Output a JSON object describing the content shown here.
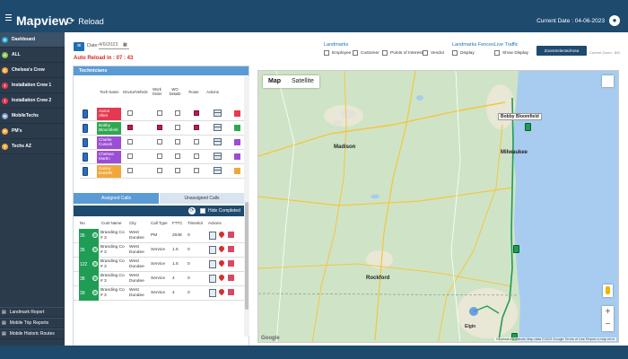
{
  "app": {
    "title": "Mapview",
    "reload_label": "Reload",
    "current_date": "Current Date : 04-06-2023"
  },
  "sidebar": {
    "items": [
      {
        "badge": "D",
        "label": "Dashboard",
        "color": "#29a3d6"
      },
      {
        "badge": "A",
        "label": "ALL",
        "color": "#8bc34a"
      },
      {
        "badge": "C",
        "label": "Chelsea's Crew",
        "color": "#f2a73b"
      },
      {
        "badge": "I",
        "label": "Installation Crew 1",
        "color": "#e53950"
      },
      {
        "badge": "I",
        "label": "Installation Crew 2",
        "color": "#e53950"
      },
      {
        "badge": "M",
        "label": "MobileTechs",
        "color": "#7a9cc6"
      },
      {
        "badge": "P",
        "label": "PM's",
        "color": "#f2a73b"
      },
      {
        "badge": "T",
        "label": "Techs AZ",
        "color": "#f2a73b"
      }
    ],
    "bottom": [
      {
        "label": "Landmark Report"
      },
      {
        "label": "Mobile Trip Reports"
      },
      {
        "label": "Mobile Historic Routes"
      }
    ]
  },
  "filters": {
    "date_label": "Date:",
    "date_value": "4/6/2023",
    "auto_reload": "Auto Reload in : 07 : 43",
    "landmarks_title": "Landmarks",
    "landmarks": [
      "Employee",
      "Customer",
      "Points of Interest",
      "Vendor"
    ],
    "fences_title": "Landmarks Fences",
    "fences": [
      "Display"
    ],
    "traffic_title": "Live Traffic",
    "traffic": [
      "Show Display"
    ],
    "zone_button": "ZoomSelectedArea",
    "current_zoom": "Current Zoom : 8/8"
  },
  "technicians": {
    "title": "Technicians",
    "columns": [
      "Tech Name",
      "Device/Vehicle",
      "Work Order",
      "WO Details",
      "Route",
      "Actions"
    ],
    "rows": [
      {
        "name": "Aaron Allen",
        "color": "#e53950",
        "checks": [
          false,
          false,
          false,
          true
        ]
      },
      {
        "name": "Bobby Bloomfield",
        "color": "#2ea84f",
        "checks": [
          true,
          true,
          false,
          true
        ]
      },
      {
        "name": "Charlie Cusack",
        "color": "#9b4dd6",
        "checks": [
          false,
          false,
          false,
          false
        ]
      },
      {
        "name": "Chelsea Martin",
        "color": "#9b4dd6",
        "checks": [
          false,
          false,
          false,
          false
        ]
      },
      {
        "name": "Danny Daniels",
        "color": "#f2a73b",
        "checks": [
          false,
          false,
          false,
          false
        ]
      }
    ]
  },
  "calls": {
    "tabs": [
      "Assigned Calls",
      "Unassigned Calls"
    ],
    "hide_completed": "Hide Completed",
    "columns": [
      "No",
      "Cust Name",
      "City",
      "Call Type",
      "FTTC",
      "Timeslot",
      "Actions"
    ],
    "rows": [
      {
        "no": "36",
        "cust": "Branding Co # 3",
        "city": "West Dundee",
        "type": "PM",
        "fttc": "2048",
        "slot": "0"
      },
      {
        "no": "35",
        "cust": "Branding Co # 3",
        "city": "West Dundee",
        "type": "Service",
        "fttc": "1.5",
        "slot": "0"
      },
      {
        "no": "122",
        "cust": "Branding Co # 3",
        "city": "West Dundee",
        "type": "Service",
        "fttc": "1.5",
        "slot": "0"
      },
      {
        "no": "38",
        "cust": "Branding Co # 3",
        "city": "West Dundee",
        "type": "Service",
        "fttc": "4",
        "slot": "0"
      },
      {
        "no": "39",
        "cust": "Branding Co # 3",
        "city": "West Dundee",
        "type": "Service",
        "fttc": "4",
        "slot": "0"
      }
    ]
  },
  "map": {
    "tabs": [
      "Map",
      "Satellite"
    ],
    "labels": {
      "madison": "Madison",
      "milwaukee": "Milwaukee",
      "rockford": "Rockford",
      "elgin": "Elgin",
      "bobby": "Bobby Bloomfield"
    },
    "attribution": "Keyboard shortcuts   Map data ©2023 Google   Terms of Use   Report a map error",
    "google": "Google"
  },
  "colors": {
    "brand": "#1e4a6e",
    "accent": "#5b9bd5",
    "alert": "#d42b1c"
  }
}
